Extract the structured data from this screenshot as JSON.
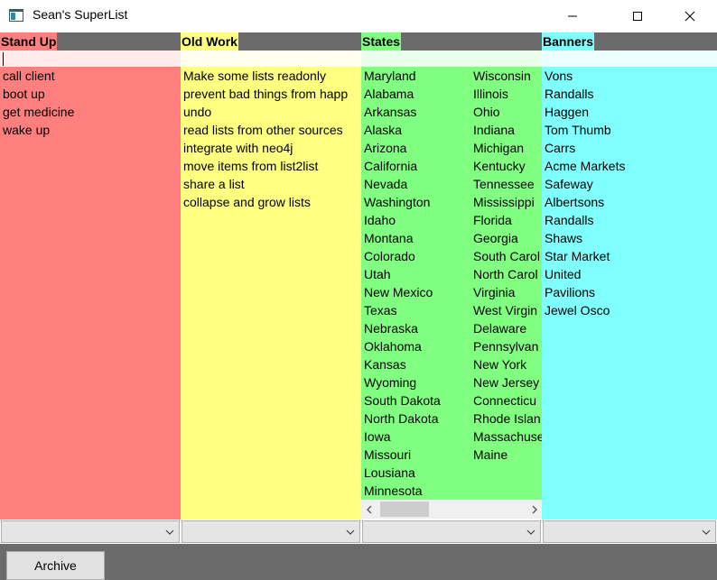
{
  "window": {
    "title": "Sean's SuperList",
    "icons": {
      "app": "app-window-icon",
      "minimize": "minimize-icon",
      "maximize": "maximize-icon",
      "close": "close-icon"
    }
  },
  "columns": [
    {
      "title": "Stand Up",
      "color": "#ff7f7f",
      "input_value": "",
      "items": [
        "call client",
        "boot up",
        "get medicine",
        "wake up"
      ]
    },
    {
      "title": "Old Work",
      "color": "#ffff80",
      "input_value": "",
      "items": [
        "Make some lists readonly",
        "prevent bad things from happ",
        "undo",
        "read lists from other sources",
        "integrate with neo4j",
        "move items from list2list",
        "share a list",
        "collapse and grow lists"
      ]
    },
    {
      "title": "States",
      "color": "#80ff80",
      "input_value": "",
      "items": [
        "Maryland",
        "Alabama",
        "Arkansas",
        "Alaska",
        "Arizona",
        "California",
        "Nevada",
        "Washington",
        "Idaho",
        "Montana",
        "Colorado",
        "Utah",
        "New Mexico",
        "Texas",
        "Nebraska",
        "Oklahoma",
        "Kansas",
        "Wyoming",
        "South Dakota",
        "North Dakota",
        "Iowa",
        "Missouri",
        "Lousiana",
        "Minnesota",
        "Wisconsin",
        "Illinois",
        "Ohio",
        "Indiana",
        "Michigan",
        "Kentucky",
        "Tennessee",
        "Mississippi",
        "Florida",
        "Georgia",
        "South Carol",
        "North Carol",
        "Virginia",
        "West Virgin",
        "Delaware",
        "Pennsylvan",
        "New York",
        "New Jersey",
        "Connecticu",
        "Rhode Islan",
        "Massachuse",
        "Maine"
      ]
    },
    {
      "title": "Banners",
      "color": "#80ffff",
      "input_value": "",
      "items": [
        "Vons",
        "Randalls",
        "Haggen",
        "Tom Thumb",
        "Carrs",
        "Acme Markets",
        "Safeway",
        "Albertsons",
        "Randalls",
        "Shaws",
        "Star Market",
        "United",
        "Pavilions",
        "Jewel Osco"
      ]
    }
  ],
  "scrollbar": {
    "left_icon": "chevron-left-icon",
    "right_icon": "chevron-right-icon"
  },
  "dropdowns": [
    {
      "selected": "",
      "icon": "chevron-down-icon"
    },
    {
      "selected": "",
      "icon": "chevron-down-icon"
    },
    {
      "selected": "",
      "icon": "chevron-down-icon"
    },
    {
      "selected": "",
      "icon": "chevron-down-icon"
    }
  ],
  "footer": {
    "archive_label": "Archive",
    "background": "#6b6b6b"
  }
}
